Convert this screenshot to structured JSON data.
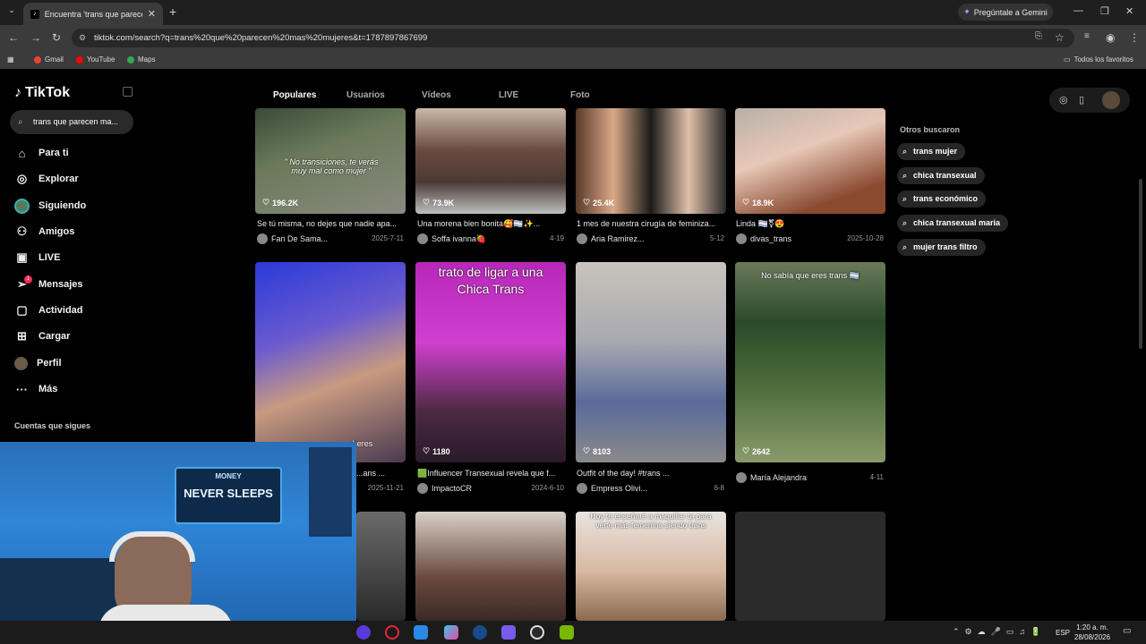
{
  "browser": {
    "tab_title": "Encuentra 'trans que parecen m",
    "url": "tiktok.com/search?q=trans%20que%20parecen%20mas%20mujeres&t=1787897867699",
    "gemini_label": "Pregúntale a Gemini",
    "bookmarks": [
      "Gmail",
      "YouTube",
      "Maps"
    ],
    "all_bookmarks": "Todos los favoritos"
  },
  "sidebar": {
    "logo": "TikTok",
    "search_value": "trans que parecen ma...",
    "items": [
      {
        "label": "Para ti",
        "icon": "home-icon"
      },
      {
        "label": "Explorar",
        "icon": "compass-icon"
      },
      {
        "label": "Siguiendo",
        "icon": "following-avatar-icon"
      },
      {
        "label": "Amigos",
        "icon": "friends-icon"
      },
      {
        "label": "LIVE",
        "icon": "live-icon"
      },
      {
        "label": "Mensajes",
        "icon": "messages-icon"
      },
      {
        "label": "Actividad",
        "icon": "activity-icon"
      },
      {
        "label": "Cargar",
        "icon": "upload-icon"
      },
      {
        "label": "Perfil",
        "icon": "profile-avatar-icon"
      },
      {
        "label": "Más",
        "icon": "more-icon"
      }
    ],
    "messages_badge": "1",
    "following_accounts_title": "Cuentas que sigues"
  },
  "search_tabs": [
    "Populares",
    "Usuarios",
    "Vídeos",
    "LIVE",
    "Foto"
  ],
  "active_tab": "Populares",
  "row1": [
    {
      "likes": "196.2K",
      "overlay": "\" No transiciones, te verás muy mal como mujer \"",
      "title": "Se tú misma, no dejes que nadie apa...",
      "author": "Fan De Sama...",
      "date": "2025-7-11"
    },
    {
      "likes": "73.9K",
      "overlay": "",
      "title": "Una morena bien bonita🥰🏳️‍⚧️✨...",
      "author": "Soffa ivanna🍓",
      "date": "4-19"
    },
    {
      "likes": "25.4K",
      "overlay": "",
      "title": "1 mes de nuestra cirugía de feminiza...",
      "author": "Aria Ramirez...",
      "date": "5-12"
    },
    {
      "likes": "18.9K",
      "overlay": "",
      "title": "Linda 🏳️‍⚧️⚧😍",
      "author": "divas_trans",
      "date": "2025-10-28"
    }
  ],
  "row2": [
    {
      "likes": "",
      "overlay": "heres",
      "title": "...ans ...",
      "author": "",
      "date": "2025-11-21"
    },
    {
      "likes": "1180",
      "overlay": "trato de ligar a una Chica Trans",
      "title": "🟩Influencer Transexual revela que f...",
      "author": "ImpactoCR",
      "date": "2024-6-10"
    },
    {
      "likes": "8103",
      "overlay": "",
      "title": "Outfit of the day! #trans ...",
      "author": "Empress Olivi...",
      "date": "6-8"
    },
    {
      "likes": "2642",
      "overlay": "No sabía que eres trans 🏳️‍⚧️",
      "title": "",
      "author": "María Alejandra",
      "date": "4-11"
    }
  ],
  "row3": [
    {
      "overlay": ""
    },
    {
      "overlay": ""
    },
    {
      "overlay": "Hoy te enseñaré a maquillar te para verte más femenina siendo trans"
    },
    {
      "overlay": ""
    }
  ],
  "others": {
    "title": "Otros buscaron",
    "items": [
      "trans mujer",
      "chica transexual",
      "trans económico",
      "chica transexual maria",
      "mujer trans filtro"
    ]
  },
  "webcam": {
    "sign_top": "MONEY",
    "sign_main": "NEVER SLEEPS"
  },
  "taskbar": {
    "lang": "ESP",
    "time": "1:20 a. m.",
    "date": "28/08/2026"
  }
}
